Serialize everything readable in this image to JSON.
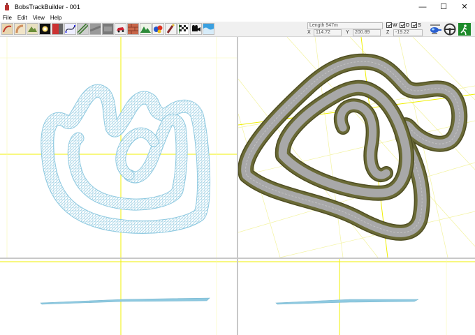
{
  "window": {
    "title": "BobsTrackBuilder - 001"
  },
  "controls": {
    "minimize": "—",
    "maximize": "☐",
    "close": "✕"
  },
  "menu": [
    "File",
    "Edit",
    "View",
    "Help"
  ],
  "toolbar_icons": [
    "track-icon",
    "road-icon",
    "terrain-icon",
    "light-icon",
    "wall-icon",
    "spline-icon",
    "road-section-icon",
    "texture-icon",
    "mesh-icon",
    "car-icon",
    "brick-icon",
    "mountain-icon",
    "objects-icon",
    "paint-icon",
    "checker-flag-icon",
    "camera-icon",
    "water-icon"
  ],
  "readout": {
    "length": "Length 947m",
    "x_label": "X",
    "x_value": "114.72",
    "y_label": "Y",
    "y_value": "200.89",
    "z_label": "Z",
    "z_value": "-19.22"
  },
  "checkboxes": [
    {
      "label": "W",
      "checked": true
    },
    {
      "label": "O",
      "checked": true
    },
    {
      "label": "S",
      "checked": true
    }
  ],
  "colors": {
    "wireframe": "#8ec9e0",
    "axis": "#f0f000",
    "grass": "#5c5a2a",
    "road": "#a8a8a8"
  }
}
